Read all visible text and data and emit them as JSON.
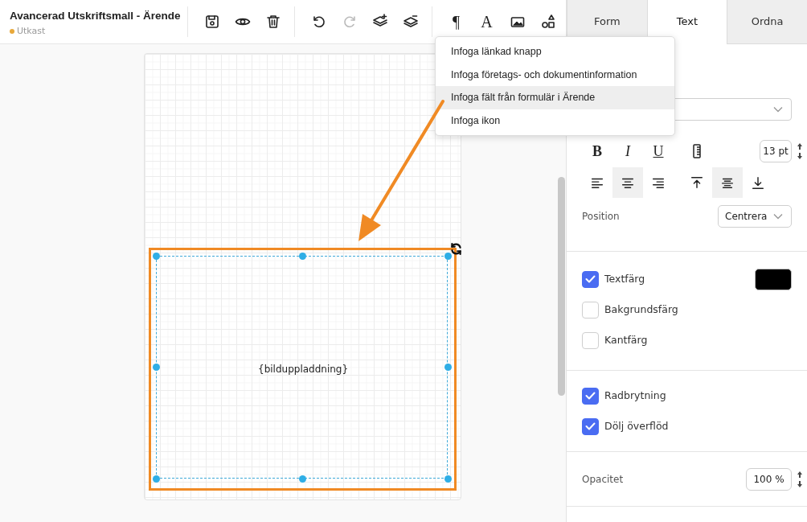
{
  "document": {
    "title": "Avancerad Utskriftsmall - Ärende",
    "status": {
      "label": "Utkast",
      "color": "#e8a83a"
    }
  },
  "toolbar_groups": [
    [
      {
        "kind": "save",
        "disabled": false
      },
      {
        "kind": "preview",
        "disabled": false
      },
      {
        "kind": "delete",
        "disabled": false
      }
    ],
    [
      {
        "kind": "undo",
        "disabled": false
      },
      {
        "kind": "redo",
        "disabled": true
      },
      {
        "kind": "layer_up",
        "disabled": false
      },
      {
        "kind": "layer_down",
        "disabled": false
      }
    ],
    [
      {
        "kind": "glyph",
        "label": "¶",
        "disabled": false
      },
      {
        "kind": "glyph",
        "label": "A",
        "disabled": false
      },
      {
        "kind": "image",
        "disabled": false
      },
      {
        "kind": "shapes",
        "disabled": false
      }
    ]
  ],
  "tabs": [
    {
      "label": "Form",
      "selected": false
    },
    {
      "label": "Text",
      "selected": true
    },
    {
      "label": "Ordna",
      "selected": false
    }
  ],
  "menu": {
    "items": [
      {
        "label": "Infoga länkad knapp",
        "selected": false
      },
      {
        "label": "Infoga företags- och dokumentinformation",
        "selected": false
      },
      {
        "label": "Infoga fält från formulär i Ärende",
        "selected": true
      },
      {
        "label": "Infoga ikon",
        "selected": false
      }
    ]
  },
  "canvas": {
    "element": {
      "text": "{bilduppladdning}",
      "selected": true
    }
  },
  "format_buttons": [
    "B",
    "I",
    "U"
  ],
  "font_size": "13 pt",
  "horizontal_align": [
    {
      "kind": "left",
      "selected": false
    },
    {
      "kind": "center",
      "selected": true
    },
    {
      "kind": "right",
      "selected": false
    }
  ],
  "vertical_align": [
    {
      "kind": "top",
      "selected": false
    },
    {
      "kind": "middle",
      "selected": true
    },
    {
      "kind": "bottom",
      "selected": false
    }
  ],
  "position": {
    "label": "Position",
    "value": "Centrera"
  },
  "color_options": [
    {
      "label": "Textfärg",
      "checked": true,
      "color": "#000000"
    },
    {
      "label": "Bakgrundsfärg",
      "checked": false
    },
    {
      "label": "Kantfärg",
      "checked": false
    }
  ],
  "text_options": [
    {
      "label": "Radbrytning",
      "checked": true
    },
    {
      "label": "Dölj överflöd",
      "checked": true
    }
  ],
  "opacity": {
    "label": "Opacitet",
    "value": "100 %"
  }
}
